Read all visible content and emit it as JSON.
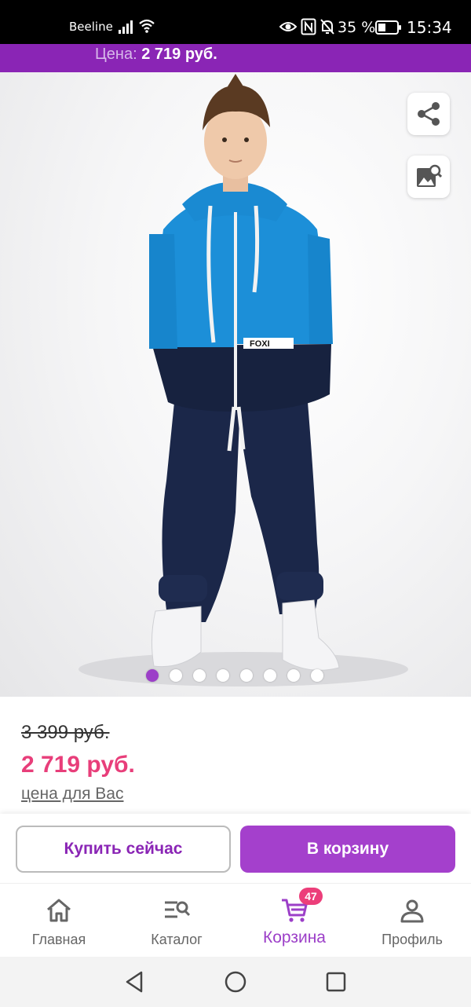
{
  "status_bar": {
    "carrier": "Beeline",
    "battery_percent": "35 %",
    "time": "15:34",
    "icons": [
      "signal-icon",
      "wifi-icon",
      "eye-icon",
      "nfc-icon",
      "bell-muted-icon",
      "battery-icon"
    ]
  },
  "header": {
    "price_label": "Цена:",
    "price_value": "2 719 руб."
  },
  "gallery": {
    "brand_tag": "FOXI",
    "image_count": 8,
    "active_index": 0,
    "share_icon": "share-icon",
    "image_search_icon": "image-search-icon"
  },
  "pricing": {
    "old_price": "3 399 руб.",
    "new_price": "2 719 руб.",
    "price_hint": "цена для Вас"
  },
  "actions": {
    "buy_now": "Купить сейчас",
    "add_to_cart": "В корзину"
  },
  "bottom_nav": {
    "items": [
      {
        "label": "Главная",
        "icon": "home-icon"
      },
      {
        "label": "Каталог",
        "icon": "catalog-search-icon"
      },
      {
        "label": "Корзина",
        "icon": "cart-icon",
        "badge": "47",
        "active": true
      },
      {
        "label": "Профиль",
        "icon": "profile-icon"
      }
    ]
  },
  "colors": {
    "brand_purple": "#8a25b5",
    "cart_button": "#a440cc",
    "sale_price": "#e83e7a",
    "badge": "#ec3e7a"
  }
}
